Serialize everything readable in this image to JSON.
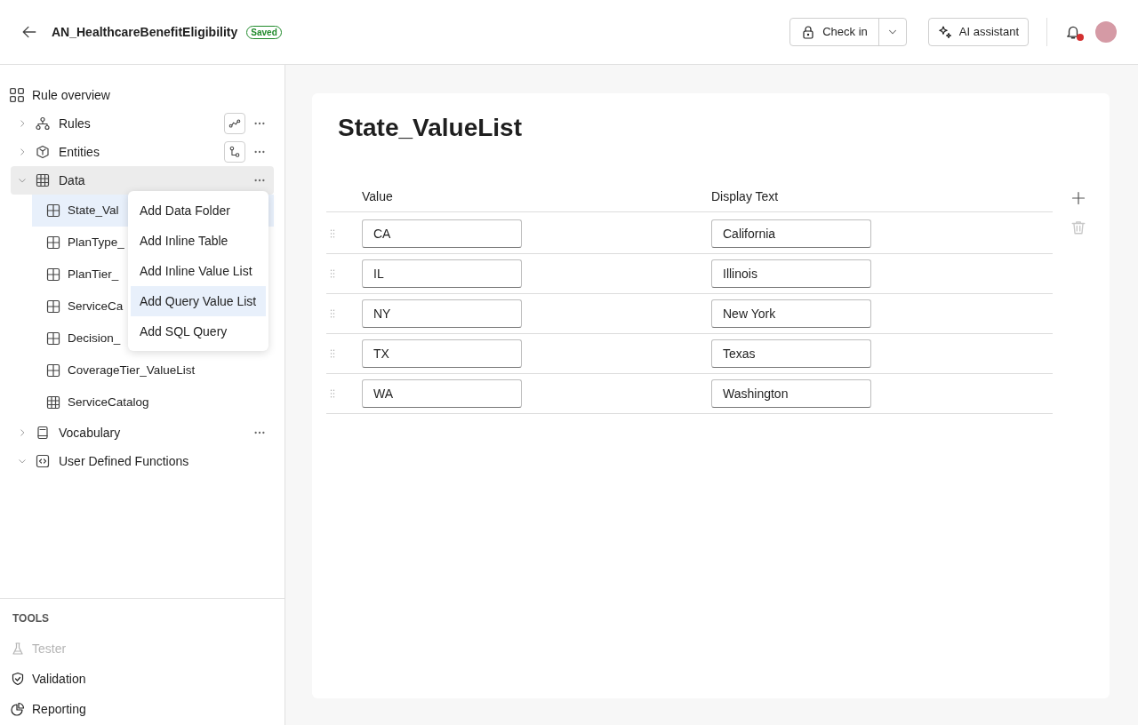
{
  "header": {
    "title": "AN_HealthcareBenefitEligibility",
    "status_badge": "Saved",
    "check_in_button": "Check in",
    "ai_button": "AI assistant",
    "notifications_unread": true
  },
  "sidebar": {
    "items": [
      {
        "label": "Rule overview",
        "kind": "overview",
        "selected": false
      },
      {
        "label": "Rules",
        "kind": "folder",
        "expanded": false,
        "selected": false,
        "action_button": true,
        "more": true
      },
      {
        "label": "Entities",
        "kind": "folder",
        "expanded": false,
        "selected": false,
        "action_button": true,
        "more": true
      },
      {
        "label": "Data",
        "kind": "folder",
        "expanded": true,
        "selected": true,
        "action_button": false,
        "more": true,
        "children": [
          {
            "label": "State_Val",
            "selected": true
          },
          {
            "label": "PlanType_",
            "selected": false
          },
          {
            "label": "PlanTier_",
            "selected": false
          },
          {
            "label": "ServiceCa",
            "selected": false
          },
          {
            "label": "Decision_",
            "selected": false
          },
          {
            "label": "CoverageTier_ValueList",
            "selected": false
          },
          {
            "label": "ServiceCatalog",
            "selected": false
          }
        ]
      },
      {
        "label": "Vocabulary",
        "kind": "folder",
        "expanded": false,
        "selected": false,
        "action_button": false,
        "more": true
      },
      {
        "label": "User Defined Functions",
        "kind": "folder",
        "expanded": true,
        "selected": false,
        "action_button": false,
        "more": false
      }
    ],
    "tools_heading": "TOOLS",
    "tools": [
      {
        "label": "Tester",
        "disabled": true
      },
      {
        "label": "Validation",
        "disabled": false
      },
      {
        "label": "Reporting",
        "disabled": false
      }
    ]
  },
  "context_menu": {
    "items": [
      {
        "label": "Add Data Folder",
        "selected": false
      },
      {
        "label": "Add Inline Table",
        "selected": false
      },
      {
        "label": "Add Inline Value List",
        "selected": false
      },
      {
        "label": "Add Query Value List",
        "selected": true
      },
      {
        "label": "Add SQL Query",
        "selected": false
      }
    ]
  },
  "editor": {
    "title": "State_ValueList",
    "table": {
      "columns": [
        "Value",
        "Display Text"
      ],
      "rows": [
        {
          "value": "CA",
          "display_text": "California"
        },
        {
          "value": "IL",
          "display_text": "Illinois"
        },
        {
          "value": "NY",
          "display_text": "New York"
        },
        {
          "value": "TX",
          "display_text": "Texas"
        },
        {
          "value": "WA",
          "display_text": "Washington"
        }
      ]
    },
    "delete_disabled": true
  }
}
